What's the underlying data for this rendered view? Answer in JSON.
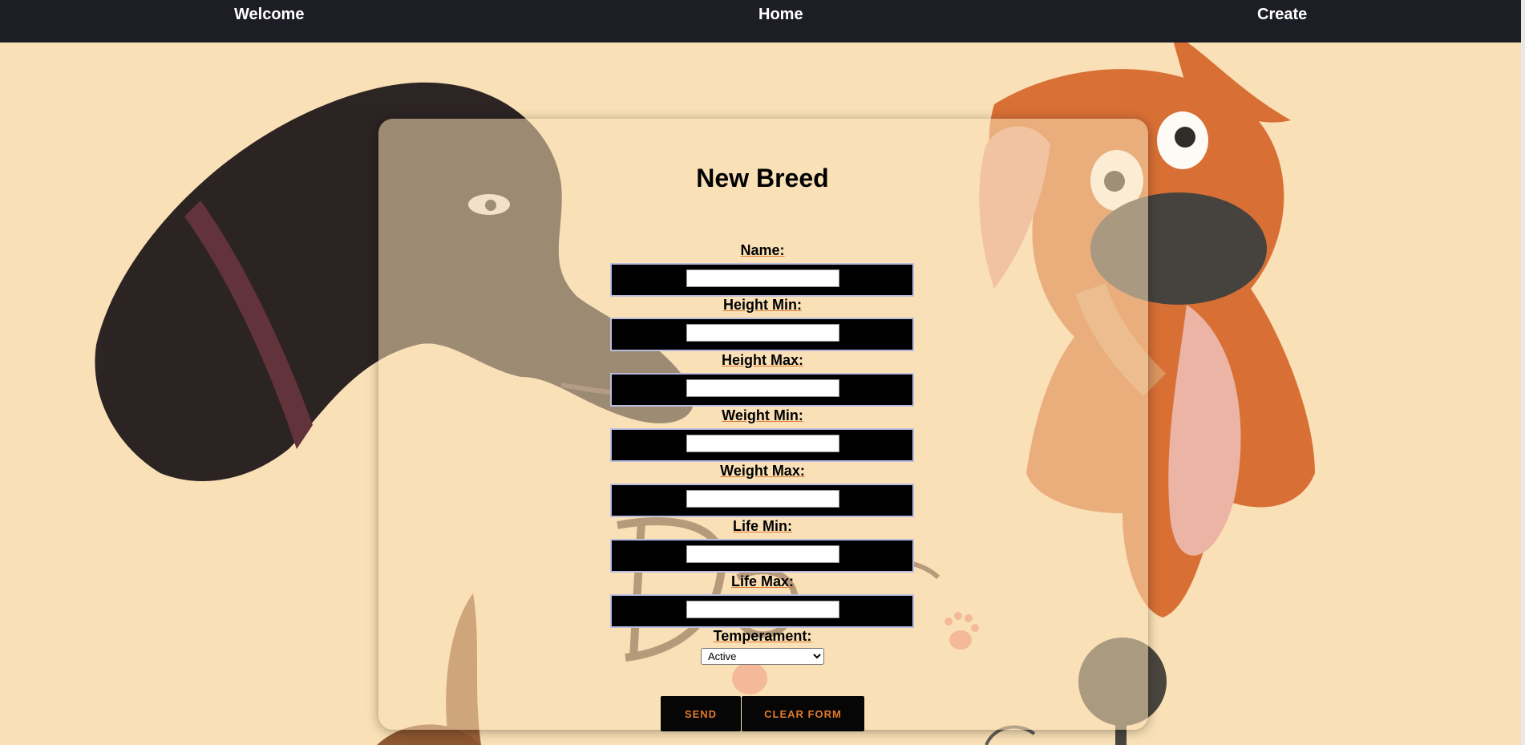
{
  "nav": {
    "welcome": "Welcome",
    "home": "Home",
    "create": "Create"
  },
  "form": {
    "title": "New Breed",
    "fields": [
      {
        "label": "Name:",
        "value": ""
      },
      {
        "label": "Height Min:",
        "value": ""
      },
      {
        "label": "Height Max:",
        "value": ""
      },
      {
        "label": "Weight Min:",
        "value": ""
      },
      {
        "label": "Weight Max:",
        "value": ""
      },
      {
        "label": "Life Min:",
        "value": ""
      },
      {
        "label": "Life Max:",
        "value": ""
      }
    ],
    "temperament": {
      "label": "Temperament:",
      "selected": "Active"
    },
    "send_label": "SEND",
    "clear_label": "CLEAR FORM"
  },
  "colors": {
    "nav_bg": "#1c1d25",
    "page_bg": "#fae0b6",
    "button_text": "#e07a2e"
  }
}
